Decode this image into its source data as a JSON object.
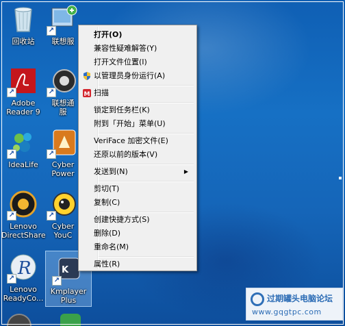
{
  "desktop": {
    "icons": [
      {
        "label": "回收站"
      },
      {
        "label": "联想服"
      },
      {
        "label": "Adobe\nReader 9"
      },
      {
        "label": "联想通\n服"
      },
      {
        "label": "IdeaLife"
      },
      {
        "label": "Cyber\nPower"
      },
      {
        "label": "Lenovo\nDirectShare"
      },
      {
        "label": "Cyber\nYouC"
      },
      {
        "label": "Lenovo\nReadyCo..."
      },
      {
        "label": "Kmplayer\nPlus"
      }
    ]
  },
  "context_menu": {
    "items": [
      {
        "label": "打开(O)",
        "icon": ""
      },
      {
        "label": "兼容性疑难解答(Y)",
        "icon": ""
      },
      {
        "label": "打开文件位置(I)",
        "icon": ""
      },
      {
        "label": "以管理员身份运行(A)",
        "icon": "uac-shield-icon"
      },
      {
        "label": "扫描",
        "icon": "scan-icon"
      },
      {
        "label": "锁定到任务栏(K)",
        "icon": ""
      },
      {
        "label": "附到「开始」菜单(U)",
        "icon": ""
      },
      {
        "label": "VeriFace 加密文件(E)",
        "icon": ""
      },
      {
        "label": "还原以前的版本(V)",
        "icon": ""
      },
      {
        "label": "发送到(N)",
        "icon": "submenu-arrow-icon"
      },
      {
        "label": "剪切(T)",
        "icon": ""
      },
      {
        "label": "复制(C)",
        "icon": ""
      },
      {
        "label": "创建快捷方式(S)",
        "icon": ""
      },
      {
        "label": "删除(D)",
        "icon": ""
      },
      {
        "label": "重命名(M)",
        "icon": ""
      },
      {
        "label": "属性(R)",
        "icon": ""
      }
    ]
  },
  "watermark": {
    "title": "过期罐头电脑论坛",
    "url": "www.gqgtpc.com"
  },
  "colors": {
    "desktop_blue": "#1263b3",
    "menu_bg": "#f0f0f0",
    "watermark_blue": "#2c6cb5"
  }
}
